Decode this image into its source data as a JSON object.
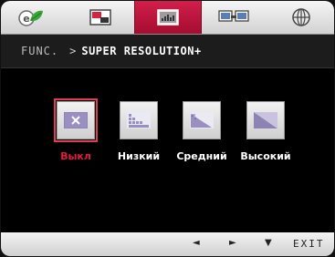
{
  "tabs": [
    {
      "icon": "eco-leaf-icon",
      "active": false
    },
    {
      "icon": "picture-icon",
      "active": false
    },
    {
      "icon": "function-icon",
      "active": true
    },
    {
      "icon": "pip-dual-screen-icon",
      "active": false
    },
    {
      "icon": "globe-setup-icon",
      "active": false
    }
  ],
  "header": {
    "root": "FUNC.",
    "separator": ">",
    "current": "SUPER RESOLUTION+"
  },
  "options": [
    {
      "label": "Выкл",
      "icon": "off-icon",
      "selected": true
    },
    {
      "label": "Низкий",
      "icon": "low-level-icon",
      "selected": false
    },
    {
      "label": "Средний",
      "icon": "medium-level-icon",
      "selected": false
    },
    {
      "label": "Высокий",
      "icon": "high-level-icon",
      "selected": false
    }
  ],
  "footer": {
    "left": "◄",
    "right": "►",
    "down": "▼",
    "exit": "EXIT"
  },
  "colors": {
    "accent": "#c8143f",
    "selected_label": "#e4193f"
  }
}
